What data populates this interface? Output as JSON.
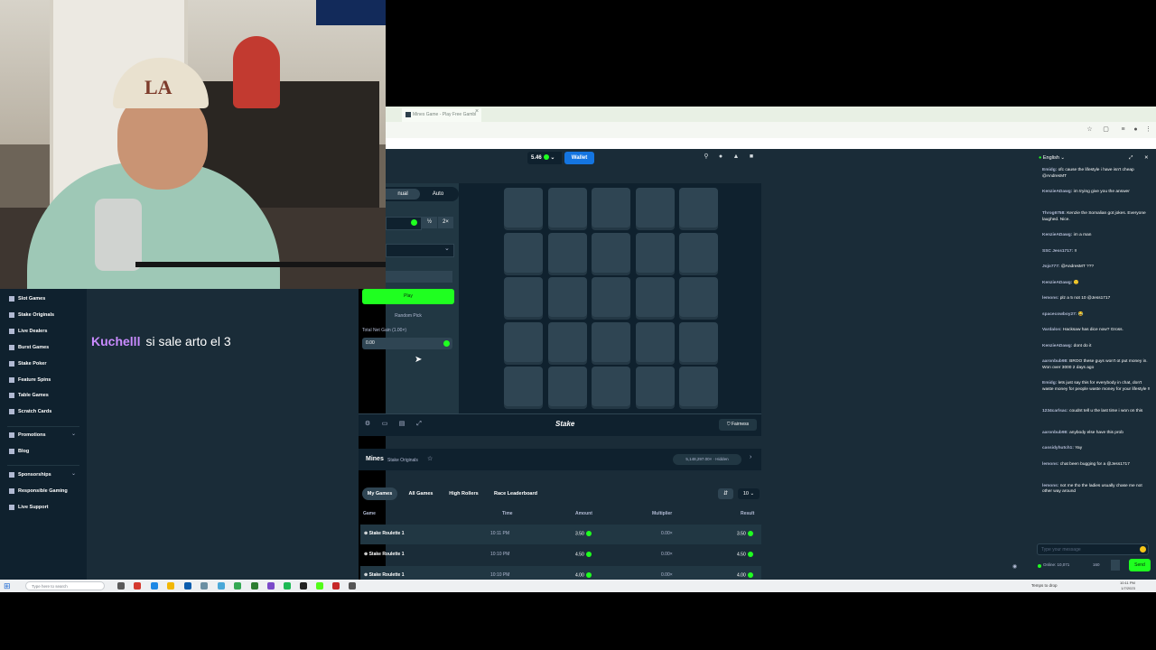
{
  "browser": {
    "tab_title": "Mines Game - Play Free Gambl",
    "tab_close": "×"
  },
  "stake": {
    "balance": "5.46",
    "wallet_label": "Wallet",
    "manual_tab": "nual",
    "auto_tab": "Auto",
    "mult_half": "½",
    "mult_double": "2×",
    "play_label": "Play",
    "random_pick": "Random Pick",
    "profit_label": "Total Net Gain (1.00×)",
    "profit_value": "0.00",
    "fairness": "Fairness",
    "logo": "Stake"
  },
  "info": {
    "title": "Mines",
    "subtitle": "Stake Originals",
    "badge": "5,148,297.00× · Hidden"
  },
  "bets": {
    "tabs": [
      "My Games",
      "All Games",
      "High Rollers",
      "Race Leaderboard"
    ],
    "count": "10",
    "headers": [
      "Game",
      "Time",
      "Amount",
      "Multiplier",
      "Result"
    ],
    "rows": [
      {
        "game": "Stake Roulette 1",
        "time": "10:11 PM",
        "amount": "3.50",
        "multiplier": "0.00×",
        "result": "3.50"
      },
      {
        "game": "Stake Roulette 1",
        "time": "10:10 PM",
        "amount": "4.50",
        "multiplier": "0.00×",
        "result": "4.50"
      },
      {
        "game": "Stake Roulette 1",
        "time": "10:10 PM",
        "amount": "4.00",
        "multiplier": "0.00×",
        "result": "4.00"
      }
    ]
  },
  "sidebar": {
    "items": [
      "Slot Games",
      "Stake Originals",
      "Live Dealers",
      "Burst Games",
      "Stake Poker",
      "Feature Spins",
      "Table Games",
      "Scratch Cards"
    ],
    "promotions": "Promotions",
    "blog": "Blog",
    "sponsorships": "Sponsorships",
    "responsible": "Responsible Gaming",
    "support": "Live Support"
  },
  "overlay_chat": {
    "user": "Kuchelll",
    "text": "si sale arto el 3"
  },
  "chat": {
    "language": "English",
    "messages": [
      {
        "user": "Emidg:",
        "text": "ofc cause the lifestyle i have isn't cheap @AndresMT"
      },
      {
        "user": "KenzieADawg:",
        "text": "im trying give you the answer"
      },
      {
        "user": "Throg6758:",
        "text": "Kenzie the Somalian got jokes. Everyone laughed. Nice."
      },
      {
        "user": "KenzieADawg:",
        "text": "im a man"
      },
      {
        "user": "SSC Jess1717:",
        "text": "!!"
      },
      {
        "user": "Jojo777:",
        "text": "@AndresMT ???"
      },
      {
        "user": "KenzieADawg:",
        "text": "🙁"
      },
      {
        "user": "lemons:",
        "text": "plz a 5 not 10 @Jess1717"
      },
      {
        "user": "spacecowboy27:",
        "text": "😂"
      },
      {
        "user": "Vardalos:",
        "text": "Hacksaw has dice now? Gross."
      },
      {
        "user": "KenzieADawg:",
        "text": "dont do it"
      },
      {
        "user": "aaronbub98:",
        "text": "BROO these guys won't ot put money in. Won over 3000 2 days ago"
      },
      {
        "user": "Emidg:",
        "text": "lets just say this for everybody in chat, don't waste money for people waste money for your lifestyle !!"
      },
      {
        "user": "1234carlsac:",
        "text": "coudnt tell u the last time i won on this"
      },
      {
        "user": "aaronbub98:",
        "text": "anybody else have this prob"
      },
      {
        "user": "cassidyhutch1:",
        "text": "Yay"
      },
      {
        "user": "lemons:",
        "text": "chat been bugging for a @Jess1717"
      },
      {
        "user": "lemons:",
        "text": "not me tho the ladies usually chase me not other way around"
      }
    ],
    "input_placeholder": "Type your message",
    "online": "Online: 10,071",
    "char_count": "160",
    "send": "Send"
  },
  "taskbar": {
    "search": "Type here to search",
    "weather": "Temps to drop",
    "time": "10:11 PM",
    "date": "1/7/2023"
  },
  "colors": {
    "bg_dark": "#0f212e",
    "bg_mid": "#1a2c38",
    "tile": "#2f4553",
    "accent_green": "#1fff20",
    "wallet_blue": "#1475e1"
  }
}
